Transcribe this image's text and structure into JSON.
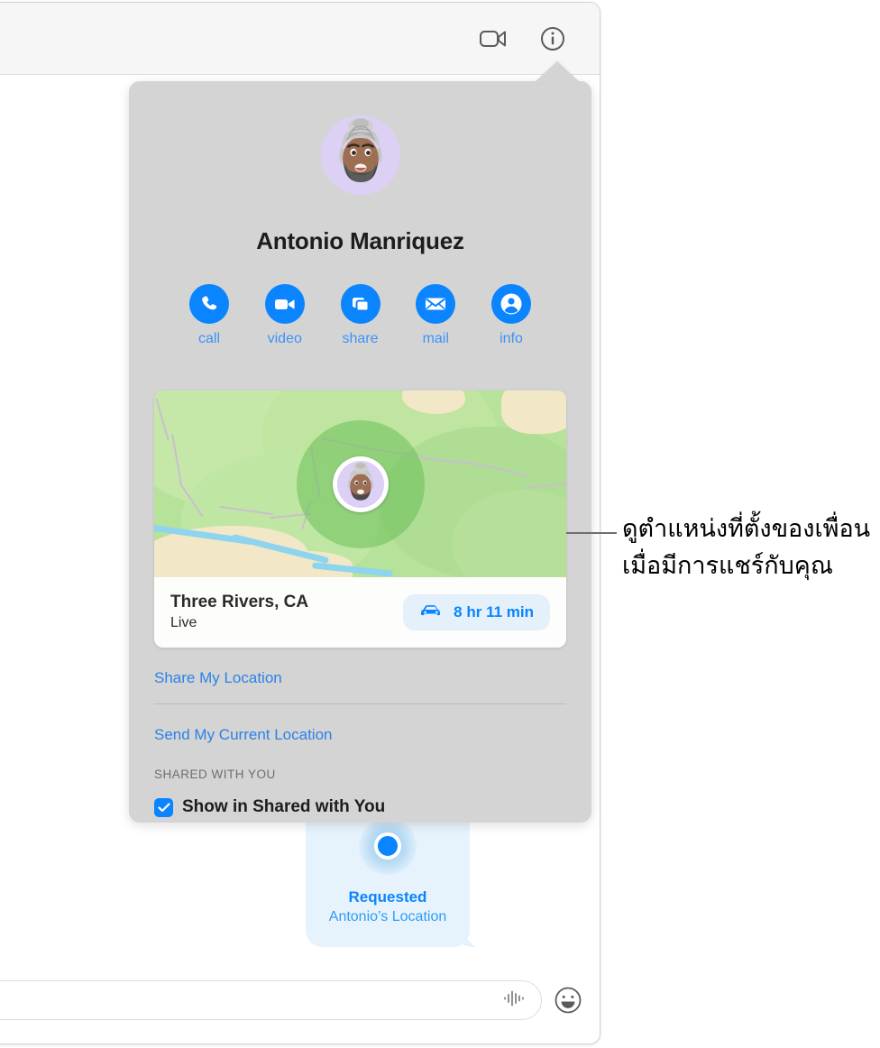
{
  "window": {
    "toolbar": {
      "video_icon": "video-camera-icon",
      "info_icon": "info-circle-icon"
    },
    "bottom_bar": {
      "input_value": "",
      "input_placeholder": "",
      "audio_icon": "audio-waveform-icon",
      "emoji_icon": "smiley-face-icon"
    }
  },
  "message": {
    "pin_icon": "location-dot-icon",
    "title": "Requested",
    "subtitle": "Antonio’s Location"
  },
  "popover": {
    "avatar_icon": "memoji-avatar",
    "contact_name": "Antonio Manriquez",
    "actions": [
      {
        "label": "call",
        "icon": "phone-icon"
      },
      {
        "label": "video",
        "icon": "video-camera-icon"
      },
      {
        "label": "share",
        "icon": "share-windows-icon"
      },
      {
        "label": "mail",
        "icon": "envelope-icon"
      },
      {
        "label": "info",
        "icon": "person-circle-icon"
      }
    ],
    "map": {
      "avatar_icon": "memoji-avatar",
      "place_name": "Three Rivers, CA",
      "place_status": "Live",
      "eta_icon": "car-icon",
      "eta_text": "8 hr 11 min"
    },
    "links": [
      {
        "label": "Share My Location"
      },
      {
        "label": "Send My Current Location"
      }
    ],
    "section_header": "SHARED WITH YOU",
    "checkbox": {
      "label": "Show in Shared with You",
      "checked": true,
      "check_icon": "checkmark-icon"
    }
  },
  "callout": {
    "text": "ดูตำแหน่งที่ตั้งของเพื่อนเมื่อมีการแชร์กับคุณ"
  },
  "colors": {
    "accent_blue": "#0a84ff",
    "link_blue": "#2c82e8",
    "popover_bg": "#d4d4d4",
    "bubble_bg": "#e7f3fc",
    "map_green": "#b7e29a"
  }
}
